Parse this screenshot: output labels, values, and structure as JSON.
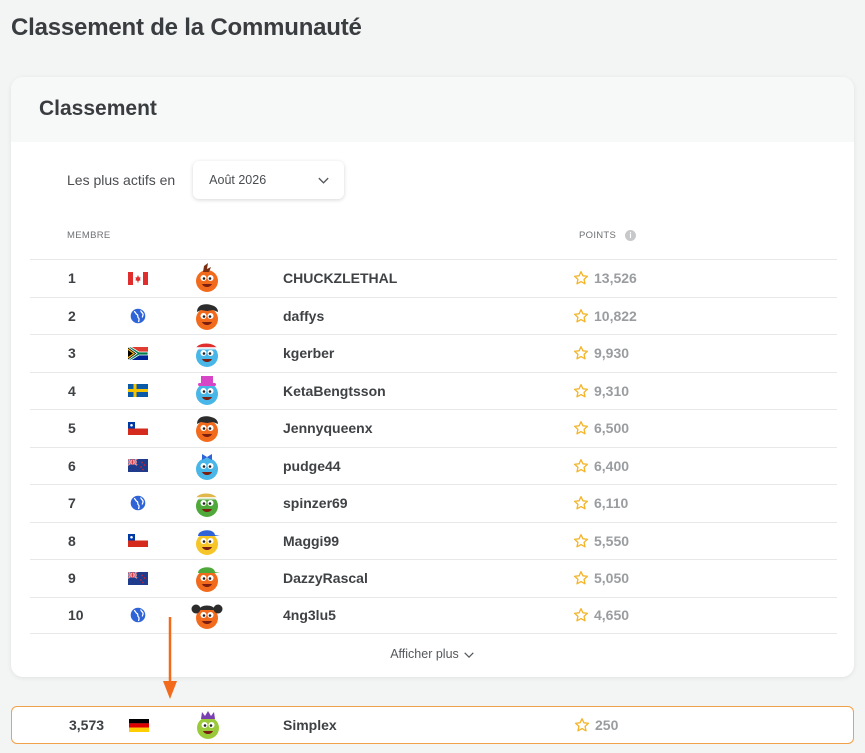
{
  "page": {
    "title": "Classement de la Communauté"
  },
  "card": {
    "title": "Classement",
    "filter_label": "Les plus actifs en",
    "month_value": "Août 2026",
    "col_member": "MEMBRE",
    "col_points": "POINTS",
    "show_more": "Afficher plus"
  },
  "rows": [
    {
      "rank": "1",
      "flag": "canada",
      "avatar": "orange-mohawk",
      "name": "CHUCKZLETHAL",
      "points": "13,526"
    },
    {
      "rank": "2",
      "flag": "globe",
      "avatar": "orange-hair",
      "name": "daffys",
      "points": "10,822"
    },
    {
      "rank": "3",
      "flag": "south-africa",
      "avatar": "blue-hat",
      "name": "kgerber",
      "points": "9,930"
    },
    {
      "rank": "4",
      "flag": "sweden",
      "avatar": "blue-tophat",
      "name": "KetaBengtsson",
      "points": "9,310"
    },
    {
      "rank": "5",
      "flag": "chile",
      "avatar": "orange-hair",
      "name": "Jennyqueenx",
      "points": "6,500"
    },
    {
      "rank": "6",
      "flag": "new-zealand",
      "avatar": "blue-bow",
      "name": "pudge44",
      "points": "6,400"
    },
    {
      "rank": "7",
      "flag": "globe",
      "avatar": "green-sombrero",
      "name": "spinzer69",
      "points": "6,110"
    },
    {
      "rank": "8",
      "flag": "chile",
      "avatar": "yellow-cap",
      "name": "Maggi99",
      "points": "5,550"
    },
    {
      "rank": "9",
      "flag": "new-zealand",
      "avatar": "orange-beanie",
      "name": "DazzyRascal",
      "points": "5,050"
    },
    {
      "rank": "10",
      "flag": "globe",
      "avatar": "orange-pigtails",
      "name": "4ng3lu5",
      "points": "4,650"
    }
  ],
  "self": {
    "rank": "3,573",
    "flag": "germany",
    "avatar": "green-crown",
    "name": "Simplex",
    "points": "250"
  },
  "colors": {
    "accent_orange": "#f26b1d",
    "star": "#f3b52a",
    "self_border": "#f0a14a",
    "globe": "#2f64d8"
  }
}
